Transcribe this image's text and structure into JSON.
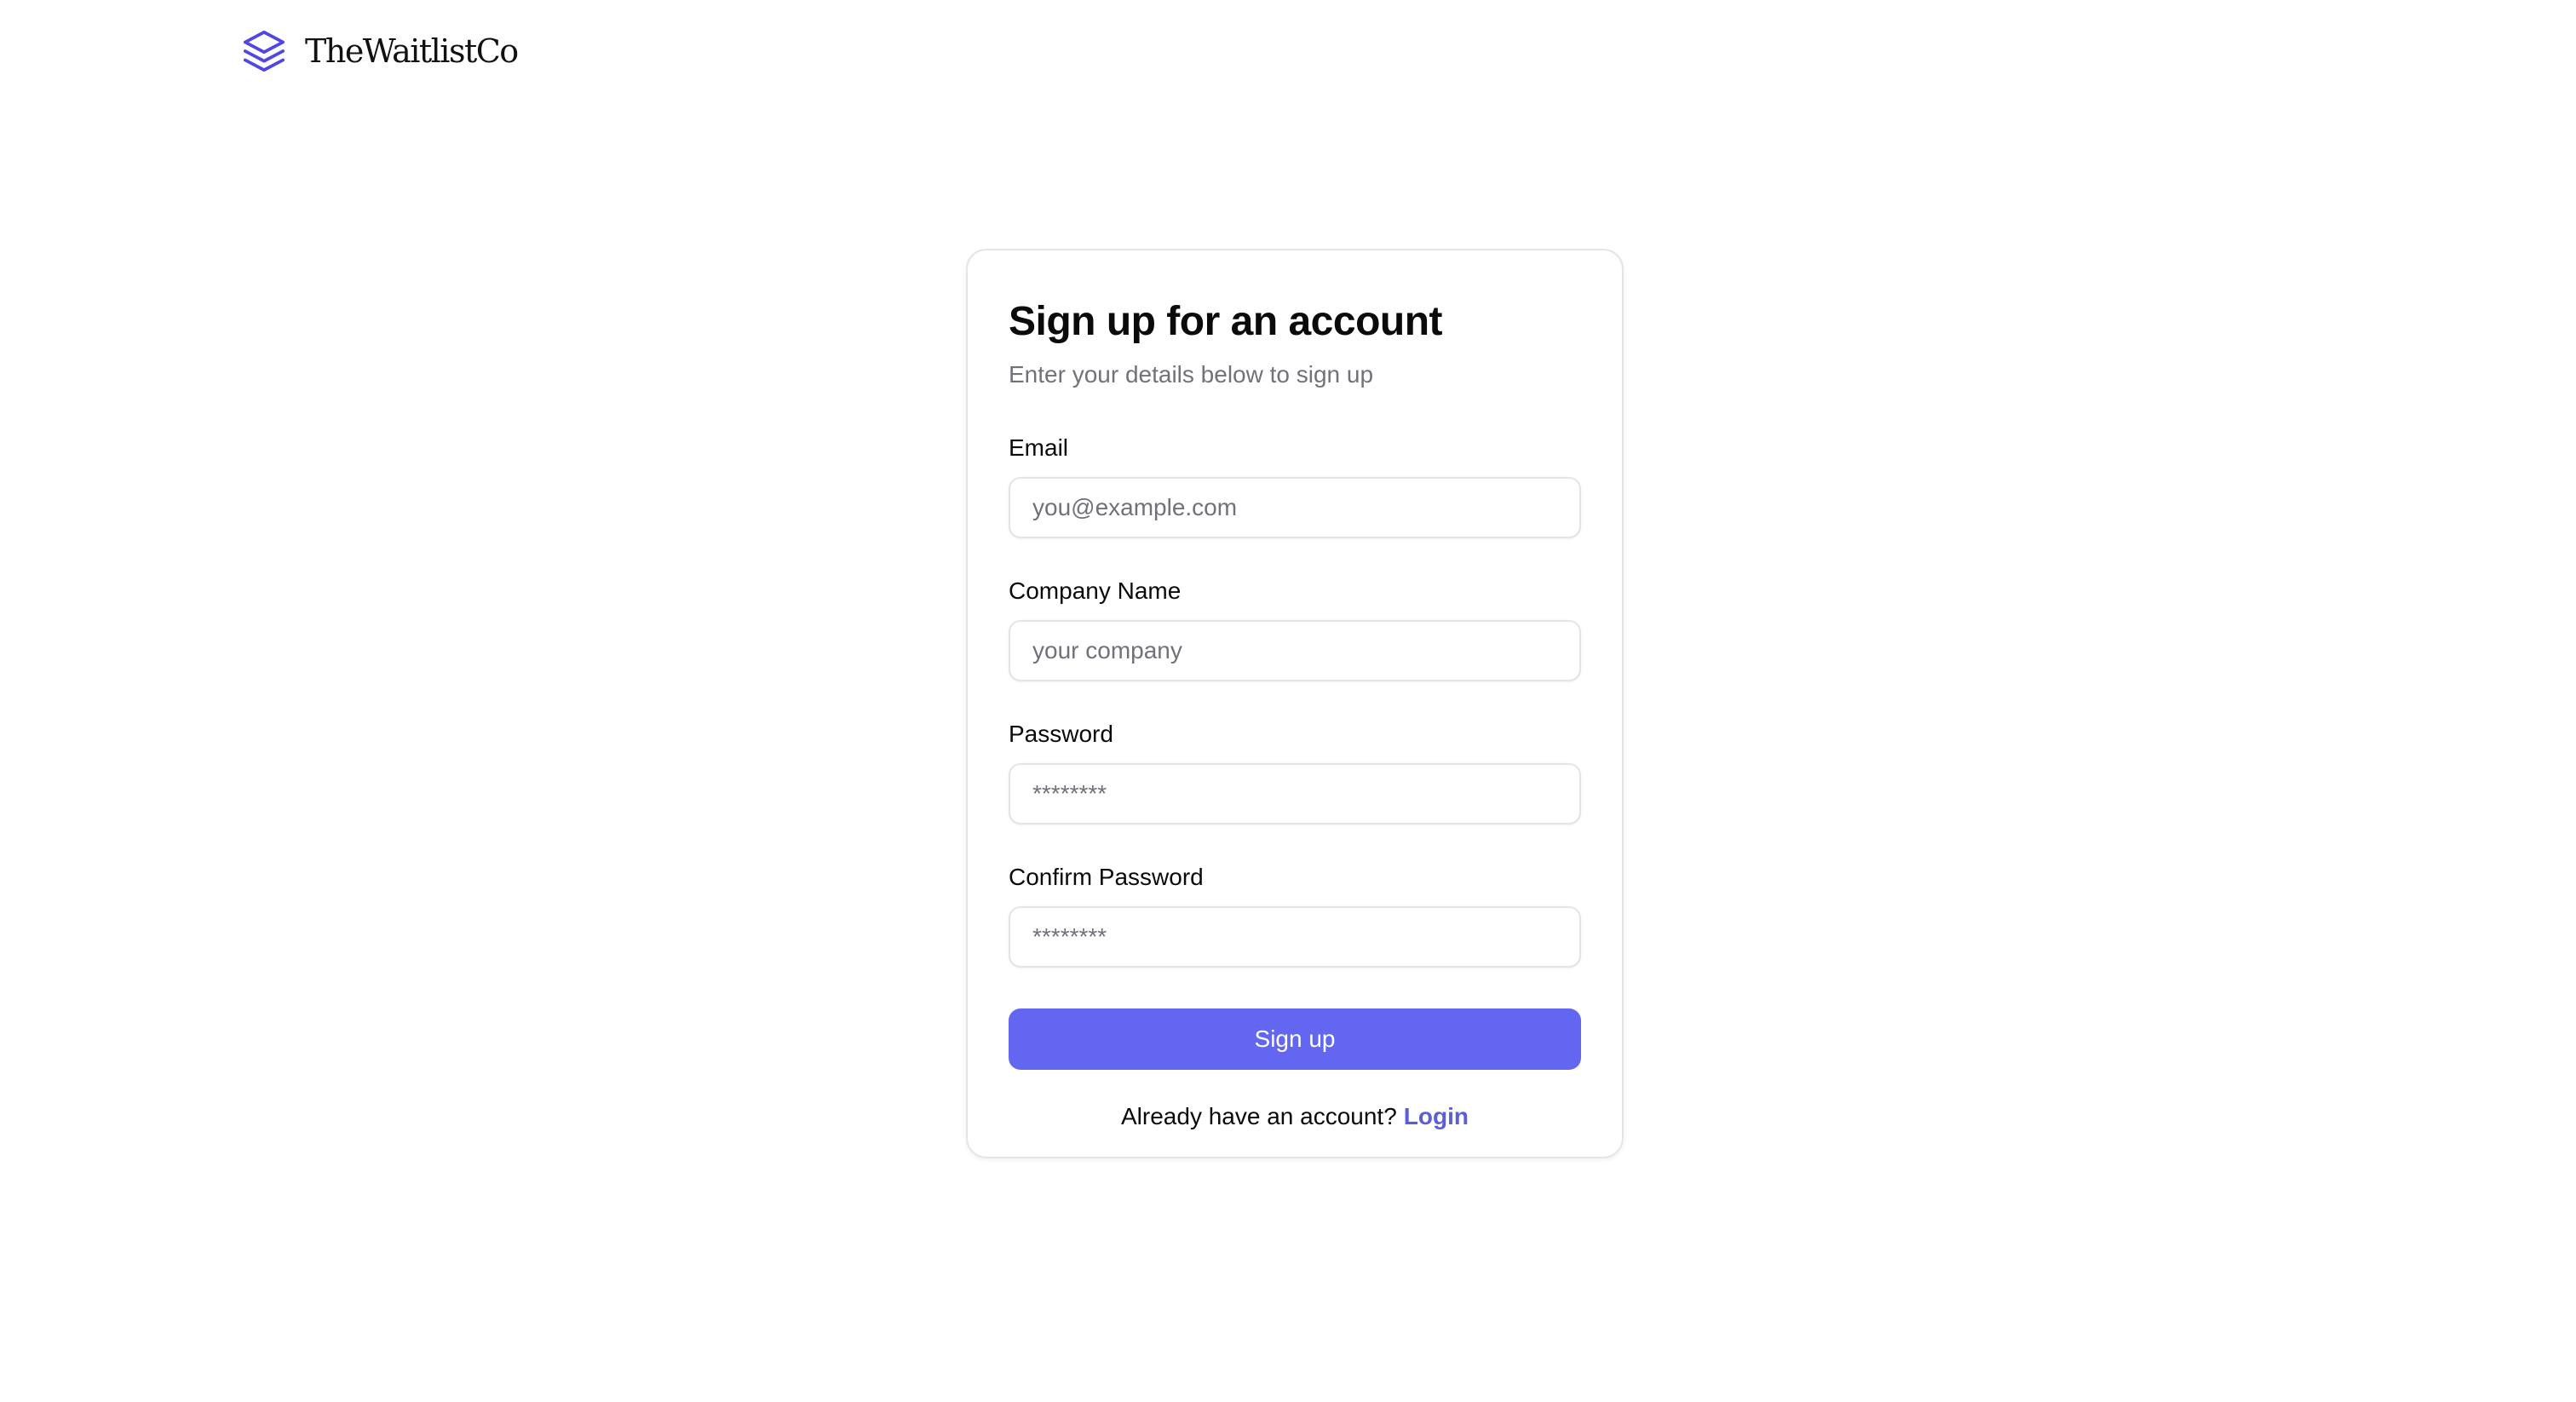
{
  "header": {
    "brand_name": "TheWaitlistCo",
    "brand_icon": "layers-icon",
    "brand_color": "#4f46e5"
  },
  "form": {
    "title": "Sign up for an account",
    "subtitle": "Enter your details below to sign up",
    "fields": [
      {
        "label": "Email",
        "placeholder": "you@example.com",
        "value": ""
      },
      {
        "label": "Company Name",
        "placeholder": "your company",
        "value": ""
      },
      {
        "label": "Password",
        "placeholder": "********",
        "value": ""
      },
      {
        "label": "Confirm Password",
        "placeholder": "********",
        "value": ""
      }
    ],
    "submit_label": "Sign up",
    "footer_text": "Already have an account?",
    "login_label": "Login"
  },
  "colors": {
    "accent": "#6366f1",
    "link": "#5b5fd6",
    "muted_text": "#71717a",
    "border": "#e4e4e7"
  }
}
